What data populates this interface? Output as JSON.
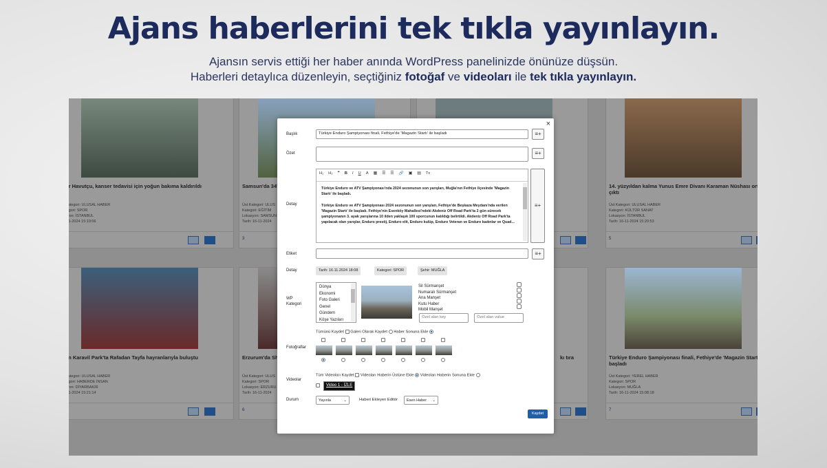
{
  "hero": {
    "title": "Ajans haberlerini tek tıkla yayınlayın.",
    "line1": "Ajansın servis ettiği her haber anında WordPress panelinizde önünüze düşsün.",
    "line2_a": "Haberleri detaylıca düzenleyin, seçtiğiniz ",
    "line2_b": "fotoğaf",
    "line2_c": " ve ",
    "line2_d": "videoları",
    "line2_e": " ile ",
    "line2_f": "tek tıkla yayınlayın."
  },
  "cards": [
    {
      "title": "ur Havutçu, kanser tedavisi için yoğun bakıma kaldırıldı",
      "meta1": "Kategori: ULUSAL HABER",
      "meta2": "tegori: SPOR",
      "meta3": "syon: İSTANBUL",
      "meta4": "-11-2024 15:19:06",
      "count": "0"
    },
    {
      "title": "Samsun'da 34'",
      "meta1": "Üst Kategori: ULUS",
      "meta2": "Kategori: EĞİTİM",
      "meta3": "Lokasyon: SAMSUN",
      "meta4": "Tarih: 16-11-2024",
      "count": "3"
    },
    {
      "title": "",
      "meta1": "",
      "meta2": "",
      "meta3": "",
      "meta4": "",
      "count": ""
    },
    {
      "title": "14. yüzyıldan kalma Yunus Emre Divanı Karaman Nüshası ortaya çıktı",
      "meta1": "Üst Kategori: ULUSAL HABER",
      "meta2": "Kategori: KÜLTÜR SANAT",
      "meta3": "Lokasyon: İSTANBUL",
      "meta4": "Tarih: 16-11-2024 15:20:53",
      "count": "5"
    },
    {
      "title": "an Karavil Park'ta Rafadan Tayfa hayranlarıyla buluştu",
      "meta1": "Kategori: ULUSAL HABER",
      "meta2": "tegori: HABERDE İNSAN",
      "meta3": "syon: DİYARBAKIR",
      "meta4": "-11-2024 15:21:14",
      "count": "0"
    },
    {
      "title": "Erzurum'da Sh",
      "meta1": "Üst Kategori: ULUS",
      "meta2": "Kategori: SPOR",
      "meta3": "Lokasyon: ERZURU",
      "meta4": "Tarih: 16-11-2024",
      "count": "6"
    },
    {
      "title": "kı tıra",
      "meta1": "",
      "meta2": "",
      "meta3": "",
      "meta4": "",
      "count": ""
    },
    {
      "title": "Türkiye Enduro Şampiyonası finali, Fethiye'de 'Magazin Startı' ile başladı",
      "meta1": "Üst Kategori: YEREL HABER",
      "meta2": "Kategori: SPOR",
      "meta3": "Lokasyon: MUĞLA",
      "meta4": "Tarih: 16-11-2024 15:08:18",
      "count": "7"
    }
  ],
  "modal": {
    "close": "×",
    "labels": {
      "baslik": "Başlık",
      "ozet": "Özet",
      "detay": "Detay",
      "etiket": "Etiket",
      "detay2": "Detay",
      "wp": "WP Kategori",
      "foto": "Fotoğraflar",
      "video": "Videolar",
      "durum": "Durum"
    },
    "baslik_value": "Türkiye Enduro Şampiyonası finali, Fethiye'de 'Magazin Startı' ile başladı",
    "toolbar": {
      "h1": "H₁",
      "h2": "H₂",
      "quote": "❞",
      "bold": "B",
      "italic": "I",
      "underline": "U",
      "color": "A",
      "bg": "▦",
      "ol": "☰",
      "ul": "☰",
      "link": "🔗",
      "image": "▣",
      "video": "▤",
      "clear": "Tx"
    },
    "detay_p1": "Türkiye Enduro ve ATV Şampiyonası'nda 2024 sezonunun son yarışları, Muğla'nın Fethiye ilçesinde 'Magazin Startı' ile başladı.",
    "detay_p2": "Türkiye Enduro ve ATV Şampiyonası 2024 sezonunun son yarışları, Fethiye'de Beşkaza Meydanı'nda verilen 'Magazin Startı' ile başladı. Fethiye'nin Esenköy Mahallesi'ndeki Akdeniz Off Road Park'ta 2 gün sürecek şampiyonanın 3. ayak yarışlarına 10 ilden yaklaşık 100 sporcunun katıldığı belirtildi. Akdeniz Off Road Park'ta yapılacak olan yarışlar, Enduro prestij, Enduro elit, Enduro kulüp, Enduro Veteran ve Enduro kadınlar ve Quad...",
    "tags": {
      "tarih": "Tarih: 16.11.2024 18:08",
      "kategori": "Kategori: SPOR",
      "sehir": "Şehir: MUĞLA"
    },
    "categories": [
      "Dünya",
      "Ekonomi",
      "Foto Galeri",
      "Genel",
      "Gündem",
      "Köşe Yazıları"
    ],
    "options": [
      "Sil Sürmanşet",
      "Numaralı Sürmanşet",
      "Ana Manşet",
      "Kutu Haber",
      "Mobil Manşet"
    ],
    "custom_key_ph": "Özel alan key",
    "custom_value_ph": "Özel alan value",
    "photo_opts": {
      "all": "Tümünü Kaydet",
      "gallery": "Galeri Olarak Kaydet",
      "end": "Haber Sonuna Ekle"
    },
    "video_opts": {
      "all": "Tüm Videoları Kaydet",
      "top": "Videoları Haberin Üstüne Ekle",
      "end": "Videoları Haberin Sonuna Ekle"
    },
    "video_btn": "Video 1 - İZLE",
    "durum_value": "Yayınla",
    "editor_label": "Haberi Ekleyen Editör",
    "editor_value": "Esen Haber",
    "save": "Kaydet",
    "icon_add": "≡+"
  },
  "colors": {
    "accent": "#1c2a5c",
    "button": "#1f5fa8"
  }
}
